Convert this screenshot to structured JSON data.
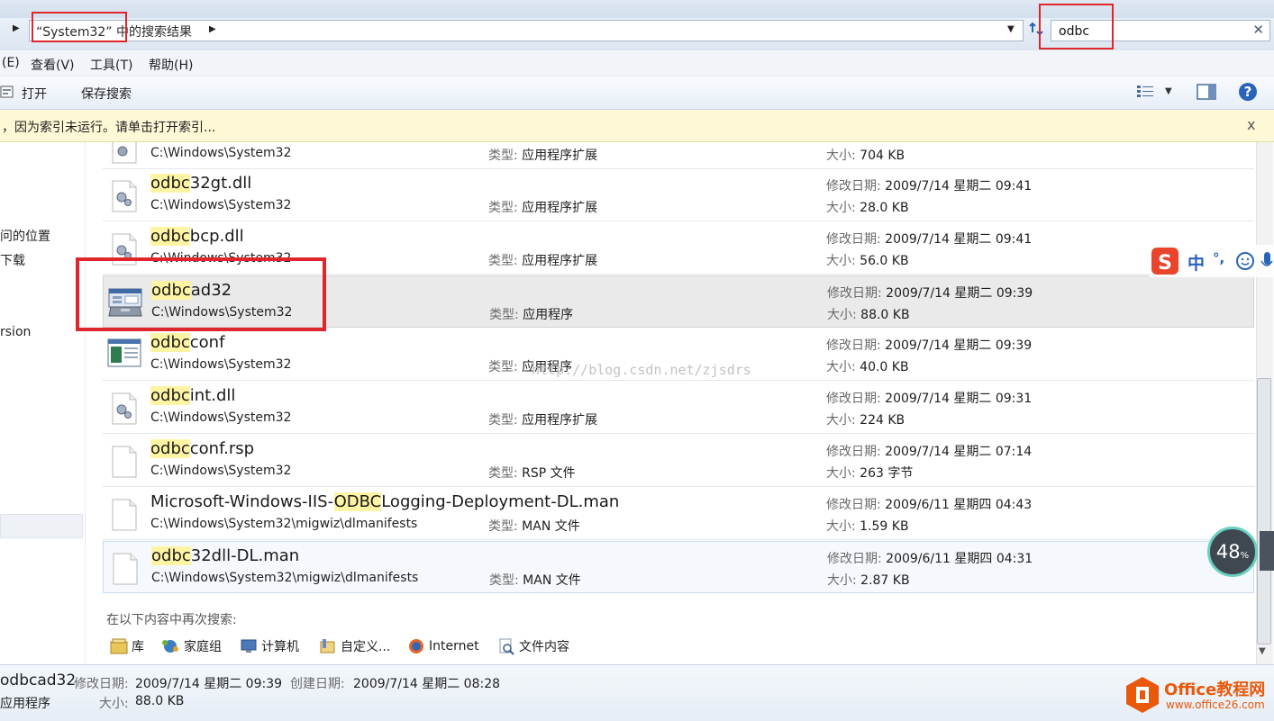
{
  "address": {
    "breadcrumb": "“System32” 中的搜索结果"
  },
  "search": {
    "value": "odbc",
    "placeholder": ""
  },
  "menu": {
    "items": [
      "(E)",
      "查看(V)",
      "工具(T)",
      "帮助(H)"
    ]
  },
  "toolbar": {
    "open_label": "打开",
    "save_search_label": "保存搜索"
  },
  "infobar": {
    "text": "，因为索引未运行。请单击打开索引...",
    "close": "x"
  },
  "nav": {
    "items": [
      "问的位置",
      "下载",
      "rsion"
    ]
  },
  "labels": {
    "type": "类型:",
    "modified": "修改日期:",
    "size": "大小:"
  },
  "results": [
    {
      "name_hl": "",
      "name_rest": "",
      "path": "C:\\Windows\\System32",
      "type": "应用程序扩展",
      "modified": "",
      "size": "704 KB"
    },
    {
      "name_hl": "odbc",
      "name_rest": "32gt.dll",
      "path": "C:\\Windows\\System32",
      "type": "应用程序扩展",
      "modified": "2009/7/14 星期二 09:41",
      "size": "28.0 KB"
    },
    {
      "name_hl": "odbc",
      "name_rest": "bcp.dll",
      "path": "C:\\Windows\\System32",
      "type": "应用程序扩展",
      "modified": "2009/7/14 星期二 09:41",
      "size": "56.0 KB"
    },
    {
      "name_hl": "odbc",
      "name_rest": "ad32",
      "path": "C:\\Windows\\System32",
      "type": "应用程序",
      "modified": "2009/7/14 星期二 09:39",
      "size": "88.0 KB"
    },
    {
      "name_hl": "odbc",
      "name_rest": "conf",
      "path": "C:\\Windows\\System32",
      "type": "应用程序",
      "modified": "2009/7/14 星期二 09:39",
      "size": "40.0 KB"
    },
    {
      "name_hl": "odbc",
      "name_rest": "int.dll",
      "path": "C:\\Windows\\System32",
      "type": "应用程序扩展",
      "modified": "2009/7/14 星期二 09:31",
      "size": "224 KB"
    },
    {
      "name_hl": "odbc",
      "name_rest": "conf.rsp",
      "path": "C:\\Windows\\System32",
      "type": "RSP 文件",
      "modified": "2009/7/14 星期二 07:14",
      "size": "263 字节"
    },
    {
      "name_pre": "Microsoft-Windows-IIS-",
      "name_hl": "ODBC",
      "name_rest": "Logging-Deployment-DL.man",
      "path": "C:\\Windows\\System32\\migwiz\\dlmanifests",
      "type": "MAN 文件",
      "modified": "2009/6/11 星期四 04:43",
      "size": "1.59 KB"
    },
    {
      "name_hl": "odbc",
      "name_rest": "32dll-DL.man",
      "path": "C:\\Windows\\System32\\migwiz\\dlmanifests",
      "type": "MAN 文件",
      "modified": "2009/6/11 星期四 04:31",
      "size": "2.87 KB"
    }
  ],
  "search_again": {
    "label": "在以下内容中再次搜索:",
    "items": [
      "库",
      "家庭组",
      "计算机",
      "自定义...",
      "Internet",
      "文件内容"
    ]
  },
  "details": {
    "name": "odbcad32",
    "type": "应用程序",
    "modified_label": "修改日期:",
    "modified": "2009/7/14 星期二 09:39",
    "created_label": "创建日期:",
    "created": "2009/7/14 星期二 08:28",
    "size_label": "大小:",
    "size": "88.0 KB"
  },
  "watermark": "http://blog.csdn.net/zjsdrs",
  "speed_meter": {
    "value": "48",
    "unit": "%"
  },
  "ime": {
    "lang": "中",
    "punct": "°,"
  },
  "logo": {
    "brand": "Office教程网",
    "url": "www.office26.com"
  },
  "colors": {
    "accent": "#2a64b8",
    "highlight": "#fff4a3",
    "annotation_red": "#e0262a",
    "logo_orange": "#e8590c"
  }
}
